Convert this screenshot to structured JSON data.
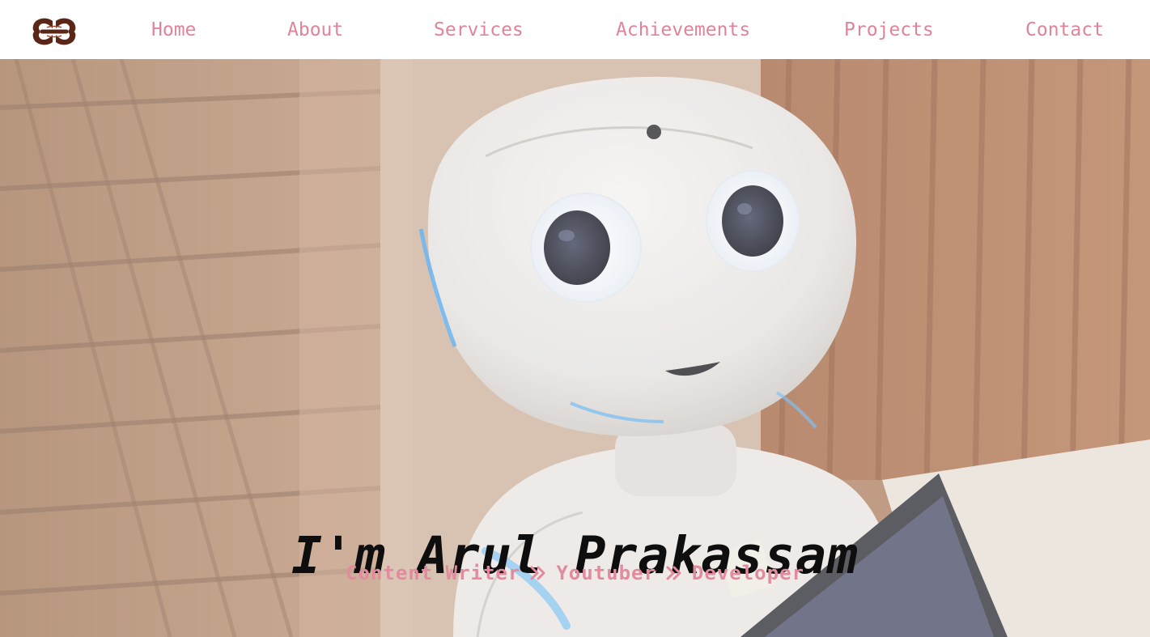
{
  "nav": {
    "logo_icon": "cc-monogram-logo-icon",
    "items": [
      {
        "label": "Home"
      },
      {
        "label": "About"
      },
      {
        "label": "Services"
      },
      {
        "label": "Achievements"
      },
      {
        "label": "Projects"
      },
      {
        "label": "Contact"
      }
    ],
    "link_color": "#e0849a"
  },
  "hero": {
    "background_image": "white humanoid robot in front of wooden wall",
    "title": "I'm Arul Prakassam",
    "roles": [
      {
        "label": "Content Writer"
      },
      {
        "label": "Youtuber"
      },
      {
        "label": "Developer"
      }
    ],
    "separator_icon": "double-chevron-right-icon",
    "role_color": "#e48a9e",
    "title_color": "#0e0e0e"
  }
}
